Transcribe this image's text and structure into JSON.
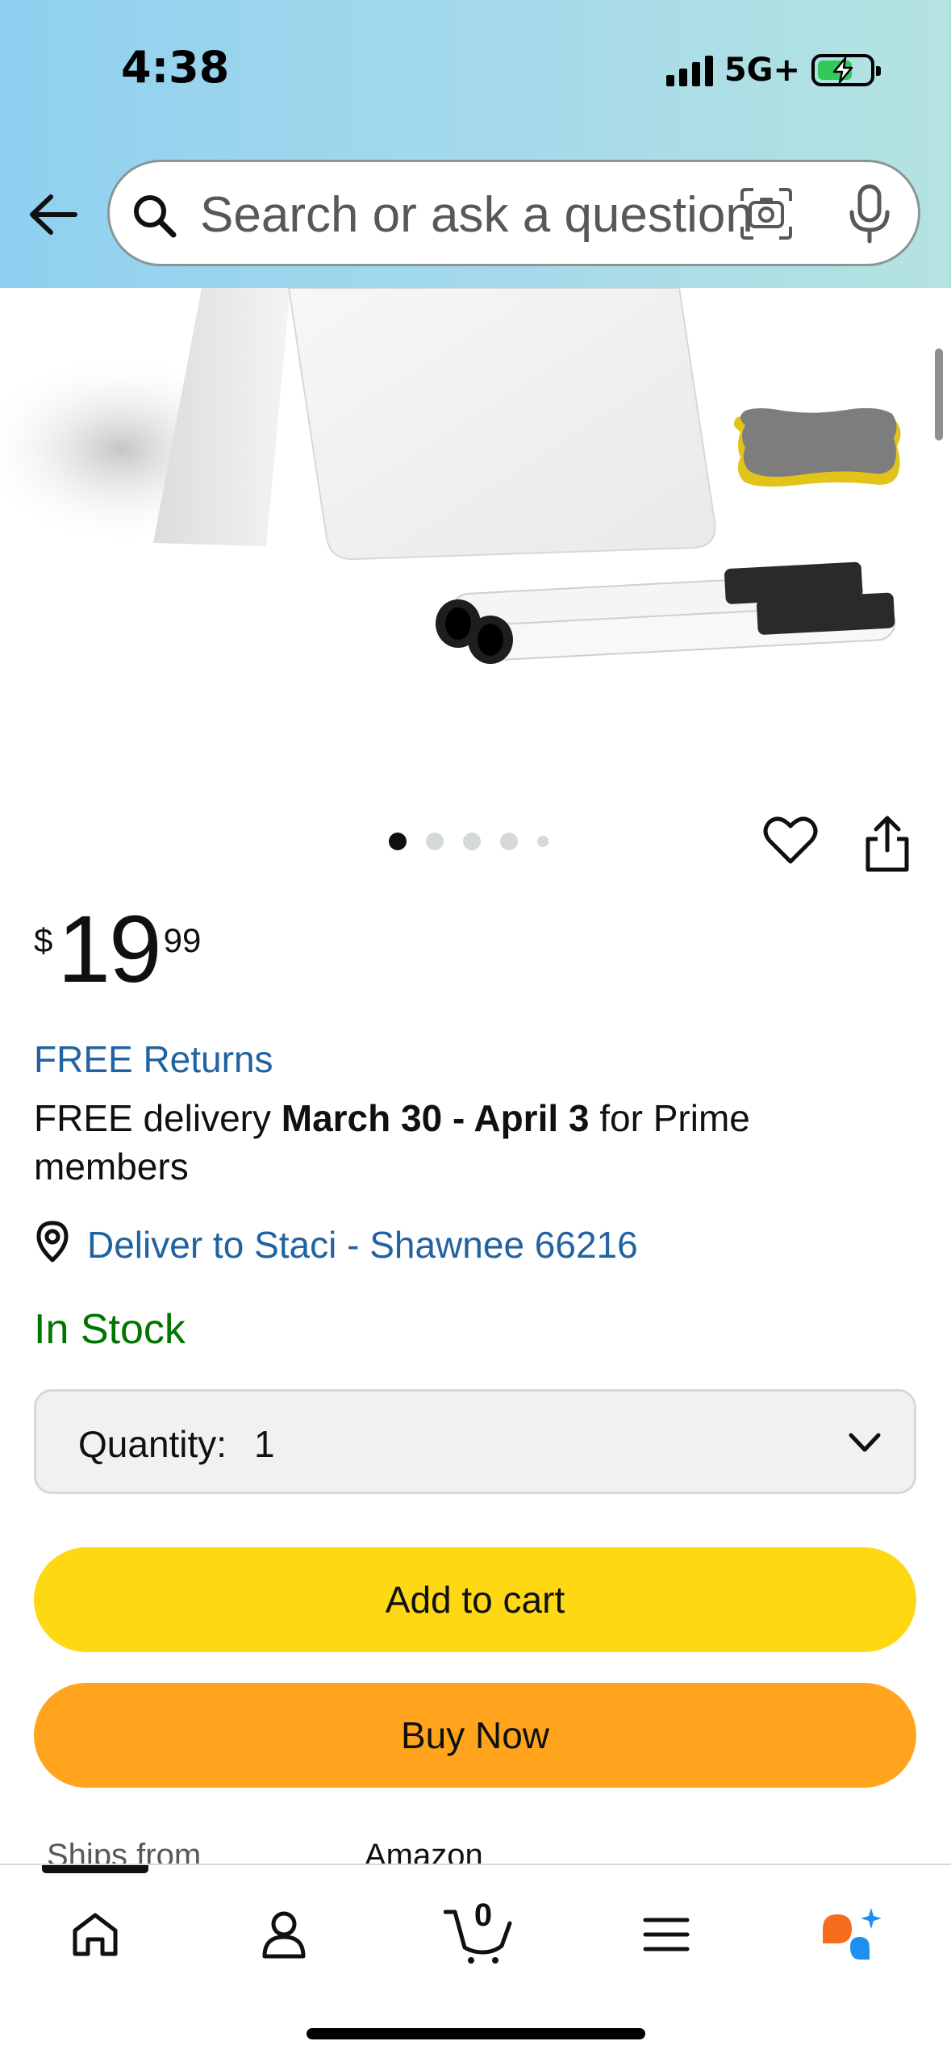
{
  "status_bar": {
    "time": "4:38",
    "network": "5G+",
    "battery_level": 0.6,
    "battery_charging": true
  },
  "header": {
    "back_icon": "arrow-left-icon",
    "search_placeholder": "Search or ask a question",
    "lens_icon": "camera-lens-icon",
    "mic_icon": "microphone-icon"
  },
  "product": {
    "image_alt": "whiteboard with markers and eraser",
    "carousel": {
      "total": 5,
      "active_index": 0
    },
    "price": {
      "symbol": "$",
      "whole": "19",
      "fraction": "99"
    },
    "free_returns": "FREE Returns",
    "delivery": {
      "prefix": "FREE delivery",
      "dates": "March 30 - April 3",
      "suffix": "for Prime members"
    },
    "deliver_to": "Deliver to Staci - Shawnee 66216",
    "stock": "In Stock",
    "quantity": {
      "label": "Quantity:",
      "value": "1"
    },
    "add_to_cart_label": "Add to cart",
    "buy_now_label": "Buy Now",
    "ships_from_label": "Ships from",
    "ships_from_value": "Amazon"
  },
  "bottom_nav": {
    "items": [
      "home-icon",
      "account-icon",
      "cart-icon",
      "menu-icon",
      "rufus-ai-icon"
    ],
    "cart_count": "0",
    "active_index": 0
  },
  "colors": {
    "link": "#2162a1",
    "in_stock": "#007600",
    "add_to_cart": "#ffd814",
    "buy_now": "#ffa41c",
    "header_gradient_start": "#8fd0f0",
    "header_gradient_end": "#b4e3e0"
  }
}
